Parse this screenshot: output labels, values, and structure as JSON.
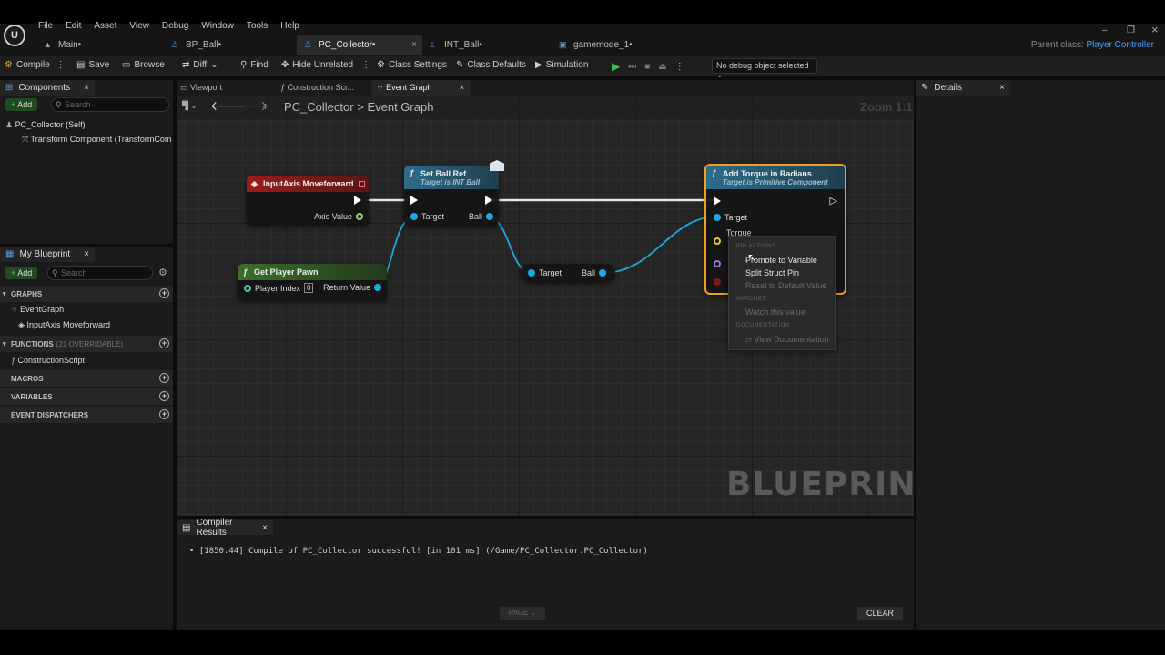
{
  "menu": [
    "File",
    "Edit",
    "Asset",
    "View",
    "Debug",
    "Window",
    "Tools",
    "Help"
  ],
  "tabs": [
    {
      "label": "Main•"
    },
    {
      "label": "BP_Ball•"
    },
    {
      "label": "PC_Collector•"
    },
    {
      "label": "INT_Ball•"
    },
    {
      "label": "gamemode_1•"
    }
  ],
  "parent_class": {
    "label": "Parent class:",
    "value": "Player Controller"
  },
  "toolbar": {
    "compile": "Compile",
    "save": "Save",
    "browse": "Browse",
    "diff": "Diff",
    "find": "Find",
    "hide_unrelated": "Hide Unrelated",
    "class_settings": "Class Settings",
    "class_defaults": "Class Defaults",
    "simulation": "Simulation",
    "debug_object": "No debug object selected"
  },
  "components": {
    "title": "Components",
    "add": "Add",
    "search_placeholder": "Search",
    "items": [
      "PC_Collector (Self)",
      "Transform Component (TransformComp"
    ]
  },
  "my_blueprint": {
    "title": "My Blueprint",
    "add": "Add",
    "search_placeholder": "Search",
    "graphs": "GRAPHS",
    "event_graph": "EventGraph",
    "input_axis": "InputAxis Moveforward",
    "functions": "FUNCTIONS",
    "functions_count": "(21 OVERRIDABLE)",
    "construction": "ConstructionScript",
    "macros": "MACROS",
    "variables": "VARIABLES",
    "dispatchers": "EVENT DISPATCHERS"
  },
  "editor_tabs": {
    "viewport": "Viewport",
    "construction": "Construction Scr...",
    "event_graph": "Event Graph"
  },
  "breadcrumb": {
    "root": "PC_Collector",
    "sep": ">",
    "current": "Event Graph",
    "zoom": "Zoom 1:1"
  },
  "nodes": {
    "input_axis": {
      "title": "InputAxis Moveforward",
      "pin": "Axis Value"
    },
    "set_ball": {
      "title": "Set Ball Ref",
      "subtitle": "Target is INT Ball",
      "target": "Target",
      "ball": "Ball"
    },
    "get_pawn": {
      "title": "Get Player Pawn",
      "index_label": "Player Index",
      "index_value": "0",
      "ret": "Return Value"
    },
    "cast": {
      "target": "Target",
      "ball": "Ball"
    },
    "torque": {
      "title": "Add Torque in Radians",
      "subtitle": "Target is Primitive Component",
      "target": "Target",
      "torque": "Torque"
    }
  },
  "context_menu": {
    "pin_actions": "PIN ACTIONS",
    "promote": "Promote to Variable",
    "split": "Split Struct Pin",
    "reset": "Reset to Default Value",
    "watches": "WATCHES",
    "watch": "Watch this value",
    "documentation": "DOCUMENTATION",
    "view_doc": "View Documentation"
  },
  "watermark": "BLUEPRINT",
  "compiler": {
    "title": "Compiler Results",
    "message": "[1850.44] Compile of PC_Collector successful! [in 101 ms] (/Game/PC_Collector.PC_Collector)",
    "page": "PAGE",
    "clear": "CLEAR"
  },
  "details": {
    "title": "Details"
  },
  "colors": {
    "exec": "#ffffff",
    "object_pin": "#1ea8e0",
    "float_pin": "#8fd36a",
    "vector_pin": "#e8c845",
    "event_header": "#8c1a1a",
    "func_header": "#2d6c8a",
    "pure_header": "#3c6a2c",
    "selected": "#f0a01e"
  }
}
